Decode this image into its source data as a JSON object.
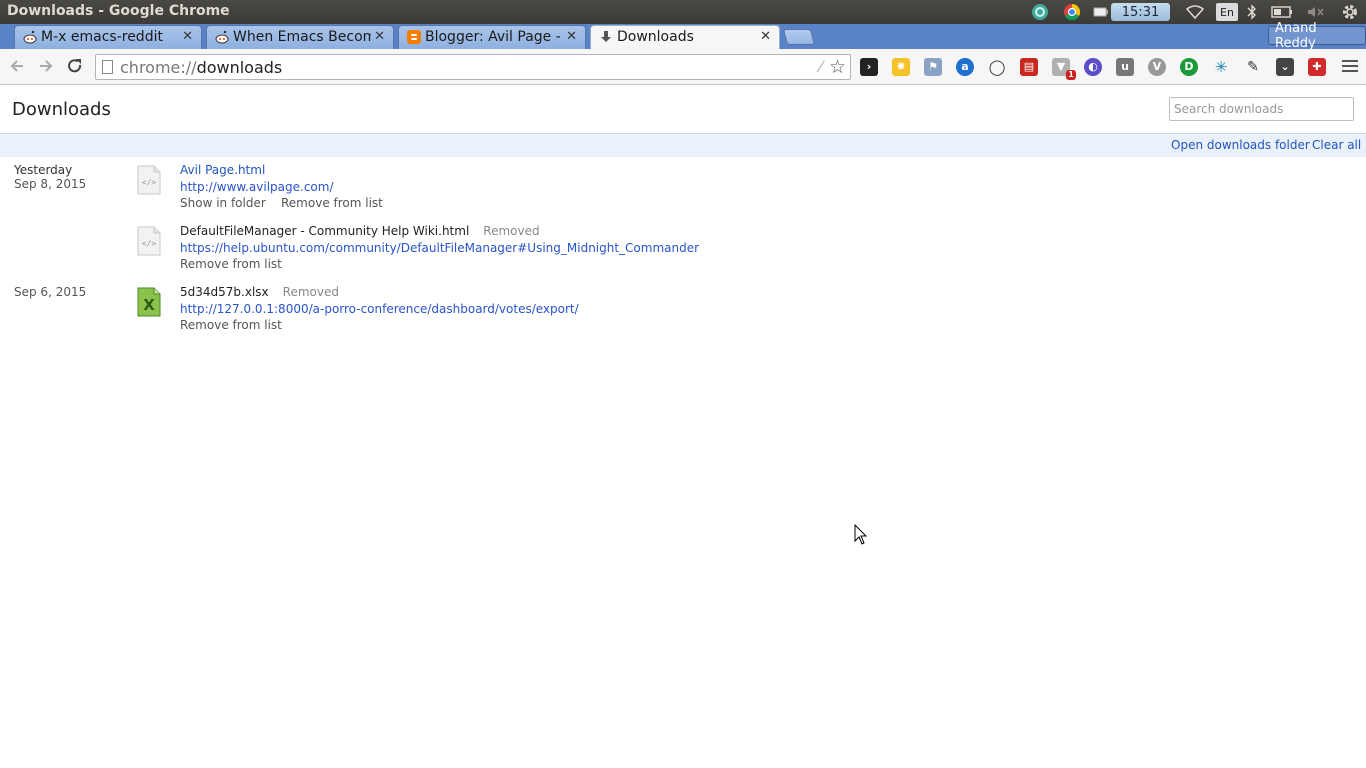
{
  "os_panel": {
    "window_title": "Downloads - Google Chrome",
    "clock": "15:31",
    "keyboard": "En"
  },
  "tabs": [
    {
      "label": "M-x emacs-reddit",
      "icon": "reddit-icon",
      "active": false
    },
    {
      "label": "When Emacs Becom",
      "icon": "reddit-icon",
      "active": false
    },
    {
      "label": "Blogger: Avil Page - ",
      "icon": "blogger-icon",
      "active": false
    },
    {
      "label": "Downloads",
      "icon": "download-icon",
      "active": true
    }
  ],
  "profile_name": "Anand Reddy",
  "omnibox": {
    "scheme": "chrome://",
    "path": "downloads"
  },
  "page": {
    "title": "Downloads",
    "search_placeholder": "Search downloads",
    "open_folder": "Open downloads folder",
    "clear_all": "Clear all"
  },
  "downloads": [
    {
      "date_label": "Yesterday",
      "date": "Sep 8, 2015",
      "file": "Avil Page.html",
      "status": "",
      "url": "http://www.avilpage.com/",
      "actions": [
        "Show in folder",
        "Remove from list"
      ],
      "icon": "html-file-icon"
    },
    {
      "date_label": "",
      "date": "",
      "file": "DefaultFileManager - Community Help Wiki.html",
      "status": "Removed",
      "url": "https://help.ubuntu.com/community/DefaultFileManager#Using_Midnight_Commander",
      "actions": [
        "Remove from list"
      ],
      "icon": "html-file-icon"
    },
    {
      "date_label": "",
      "date": "Sep 6, 2015",
      "file": "5d34d57b.xlsx",
      "status": "Removed",
      "url": "http://127.0.0.1:8000/a-porro-conference/dashboard/votes/export/",
      "actions": [
        "Remove from list"
      ],
      "icon": "excel-file-icon"
    }
  ],
  "colors": {
    "link": "#2255bb",
    "tabstrip": "#5a83c7",
    "actionbar": "#ebf1fa"
  }
}
